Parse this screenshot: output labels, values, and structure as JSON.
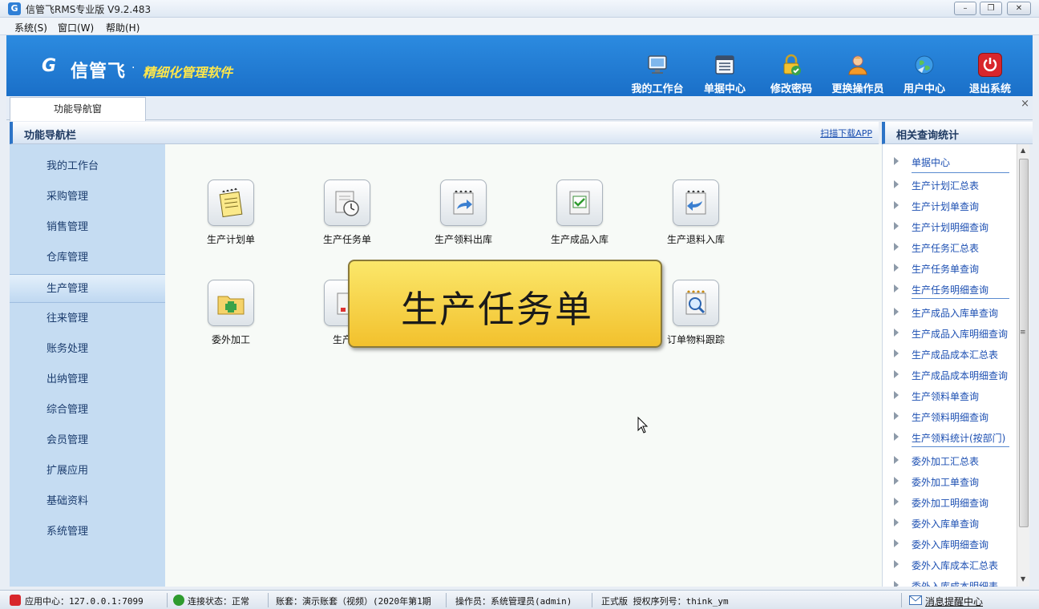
{
  "window": {
    "title": "信管飞RMS专业版 V9.2.483",
    "minimize": "–",
    "maximize": "❐",
    "close": "✕"
  },
  "menu": [
    "系统(S)",
    "窗口(W)",
    "帮助(H)"
  ],
  "banner": {
    "logo_mark": "G",
    "logo_name": "信管飞",
    "logo_dot": "·",
    "slogan": "精细化管理软件",
    "tools": [
      {
        "label": "我的工作台",
        "icon": "monitor-icon"
      },
      {
        "label": "单据中心",
        "icon": "document-list-icon"
      },
      {
        "label": "修改密码",
        "icon": "lock-check-icon"
      },
      {
        "label": "更换操作员",
        "icon": "user-icon"
      },
      {
        "label": "用户中心",
        "icon": "globe-icon"
      },
      {
        "label": "退出系统",
        "icon": "power-icon"
      }
    ]
  },
  "tabs": [
    {
      "label": "功能导航窗"
    }
  ],
  "tab_close": "×",
  "nav": {
    "title": "功能导航栏",
    "scan_link": "扫描下载APP",
    "items": [
      "我的工作台",
      "采购管理",
      "销售管理",
      "仓库管理",
      "生产管理",
      "往来管理",
      "账务处理",
      "出纳管理",
      "综合管理",
      "会员管理",
      "扩展应用",
      "基础资料",
      "系统管理"
    ],
    "active": "生产管理"
  },
  "functions": [
    {
      "label": "生产计划单",
      "icon": "notepad-icon"
    },
    {
      "label": "生产任务单",
      "icon": "clock-document-icon"
    },
    {
      "label": "生产领料出库",
      "icon": "arrow-out-document-icon"
    },
    {
      "label": "生产成品入库",
      "icon": "check-document-icon"
    },
    {
      "label": "生产退料入库",
      "icon": "arrow-back-document-icon"
    },
    {
      "label": "委外加工",
      "icon": "folder-add-icon"
    },
    {
      "label": "生产模",
      "icon": "gear-document-icon"
    },
    {
      "label": "订单物料跟踪",
      "icon": "magnifier-document-icon"
    }
  ],
  "tooltip": "生产任务单",
  "related": {
    "title": "相关查询统计",
    "items": [
      "单据中心",
      "生产计划汇总表",
      "生产计划单查询",
      "生产计划明细查询",
      "生产任务汇总表",
      "生产任务单查询",
      "生产任务明细查询",
      "生产成品入库单查询",
      "生产成品入库明细查询",
      "生产成品成本汇总表",
      "生产成品成本明细查询",
      "生产领料单查询",
      "生产领料明细查询",
      "生产领料统计(按部门)",
      "委外加工汇总表",
      "委外加工单查询",
      "委外加工明细查询",
      "委外入库单查询",
      "委外入库明细查询",
      "委外入库成本汇总表",
      "委外入库成本明细表"
    ]
  },
  "status": {
    "app_center": "应用中心：127.0.0.1:7099",
    "connection": "连接状态：正常",
    "account": "账套：演示账套（视频）(2020年第1期",
    "operator": "操作员：系统管理员(admin)",
    "license": "正式版 授权序列号：think_ym",
    "notify": "消息提醒中心"
  },
  "colors": {
    "banner": "#1f7ad4",
    "sidebar": "#c5dcf2",
    "tooltip": "#f6d34a",
    "link": "#1c4fb2"
  }
}
